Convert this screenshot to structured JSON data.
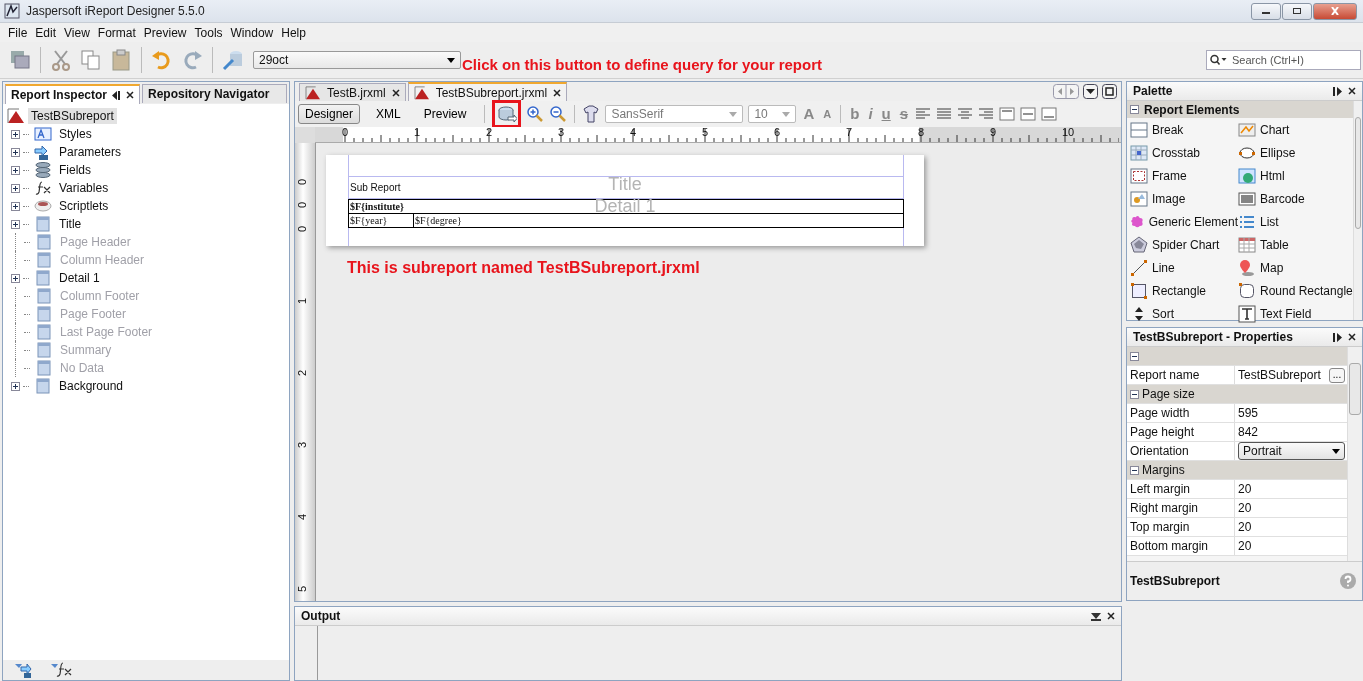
{
  "window": {
    "title": "Jaspersoft iReport Designer 5.5.0"
  },
  "menu": [
    "File",
    "Edit",
    "View",
    "Format",
    "Preview",
    "Tools",
    "Window",
    "Help"
  ],
  "toolbar": {
    "datasource": "29oct",
    "search_placeholder": "Search (Ctrl+I)"
  },
  "annotations": [
    "Click on this button to define query for your report",
    "This is subreport named TestBSubreport.jrxml"
  ],
  "left_panel": {
    "tabs": [
      {
        "label": "Report Inspector",
        "selected": true
      },
      {
        "label": "Repository Navigator",
        "selected": false
      }
    ],
    "root": "TestBSubreport",
    "tree": [
      {
        "label": "Styles",
        "kind": "styles",
        "expander": true,
        "disabled": false
      },
      {
        "label": "Parameters",
        "kind": "parameters",
        "expander": true,
        "disabled": false
      },
      {
        "label": "Fields",
        "kind": "fields",
        "expander": true,
        "disabled": false
      },
      {
        "label": "Variables",
        "kind": "variables",
        "expander": true,
        "disabled": false
      },
      {
        "label": "Scriptlets",
        "kind": "scriptlets",
        "expander": true,
        "disabled": false
      },
      {
        "label": "Title",
        "kind": "band",
        "expander": true,
        "disabled": false
      },
      {
        "label": "Page Header",
        "kind": "band",
        "expander": false,
        "disabled": true
      },
      {
        "label": "Column Header",
        "kind": "band",
        "expander": false,
        "disabled": true
      },
      {
        "label": "Detail 1",
        "kind": "band",
        "expander": true,
        "disabled": false
      },
      {
        "label": "Column Footer",
        "kind": "band",
        "expander": false,
        "disabled": true
      },
      {
        "label": "Page Footer",
        "kind": "band",
        "expander": false,
        "disabled": true
      },
      {
        "label": "Last Page Footer",
        "kind": "band",
        "expander": false,
        "disabled": true
      },
      {
        "label": "Summary",
        "kind": "band",
        "expander": false,
        "disabled": true
      },
      {
        "label": "No Data",
        "kind": "band",
        "expander": false,
        "disabled": true
      },
      {
        "label": "Background",
        "kind": "band",
        "expander": true,
        "disabled": false
      }
    ]
  },
  "editor": {
    "tabs": [
      {
        "label": "TestB.jrxml",
        "selected": false
      },
      {
        "label": "TestBSubreport.jrxml",
        "selected": true
      }
    ],
    "views": [
      {
        "label": "Designer",
        "selected": true
      },
      {
        "label": "XML",
        "selected": false
      },
      {
        "label": "Preview",
        "selected": false
      }
    ],
    "font": "SansSerif",
    "size": "10",
    "size_buttons": [
      "A",
      "A"
    ],
    "style_buttons": [
      "b",
      "i",
      "u",
      "s"
    ],
    "ruler": [
      "0",
      "1",
      "2",
      "3",
      "4",
      "5",
      "6",
      "7",
      "8",
      "9",
      "10"
    ],
    "vruler": [
      "0",
      "0",
      "0",
      "1",
      "2",
      "3",
      "4",
      "5"
    ],
    "report": {
      "title_text": "Sub Report",
      "band_labels": [
        "Title",
        "Detail 1"
      ],
      "group_field": "$F{institute}",
      "fields": [
        "$F{year}",
        "$F{degree}"
      ]
    }
  },
  "output": {
    "title": "Output"
  },
  "palette": {
    "title": "Palette",
    "section": "Report Elements",
    "items": [
      {
        "label": "Break",
        "kind": "break"
      },
      {
        "label": "Chart",
        "kind": "chart"
      },
      {
        "label": "Crosstab",
        "kind": "crosstab"
      },
      {
        "label": "Ellipse",
        "kind": "ellipse"
      },
      {
        "label": "Frame",
        "kind": "frame"
      },
      {
        "label": "Html",
        "kind": "html"
      },
      {
        "label": "Image",
        "kind": "image"
      },
      {
        "label": "Barcode",
        "kind": "barcode"
      },
      {
        "label": "Generic Element",
        "kind": "generic"
      },
      {
        "label": "List",
        "kind": "list"
      },
      {
        "label": "Spider Chart",
        "kind": "spider"
      },
      {
        "label": "Table",
        "kind": "table"
      },
      {
        "label": "Line",
        "kind": "line"
      },
      {
        "label": "Map",
        "kind": "map"
      },
      {
        "label": "Rectangle",
        "kind": "rectangle"
      },
      {
        "label": "Round Rectangle",
        "kind": "roundrect"
      },
      {
        "label": "Sort",
        "kind": "sort"
      },
      {
        "label": "Text Field",
        "kind": "textfield"
      }
    ]
  },
  "properties": {
    "title": "TestBSubreport - Properties",
    "rows": [
      {
        "kind": "section"
      },
      {
        "kind": "button",
        "label": "Report name",
        "value": "TestBSubreport",
        "button_text": "..."
      },
      {
        "kind": "section",
        "label": "Page size"
      },
      {
        "kind": "text",
        "label": "Page width",
        "value": "595"
      },
      {
        "kind": "text",
        "label": "Page height",
        "value": "842"
      },
      {
        "kind": "select",
        "label": "Orientation",
        "value": "Portrait"
      },
      {
        "kind": "section",
        "label": "Margins"
      },
      {
        "kind": "text",
        "label": "Left margin",
        "value": "20"
      },
      {
        "kind": "text",
        "label": "Right margin",
        "value": "20"
      },
      {
        "kind": "text",
        "label": "Top margin",
        "value": "20"
      },
      {
        "kind": "text",
        "label": "Bottom margin",
        "value": "20"
      }
    ],
    "footer": "TestBSubreport"
  }
}
